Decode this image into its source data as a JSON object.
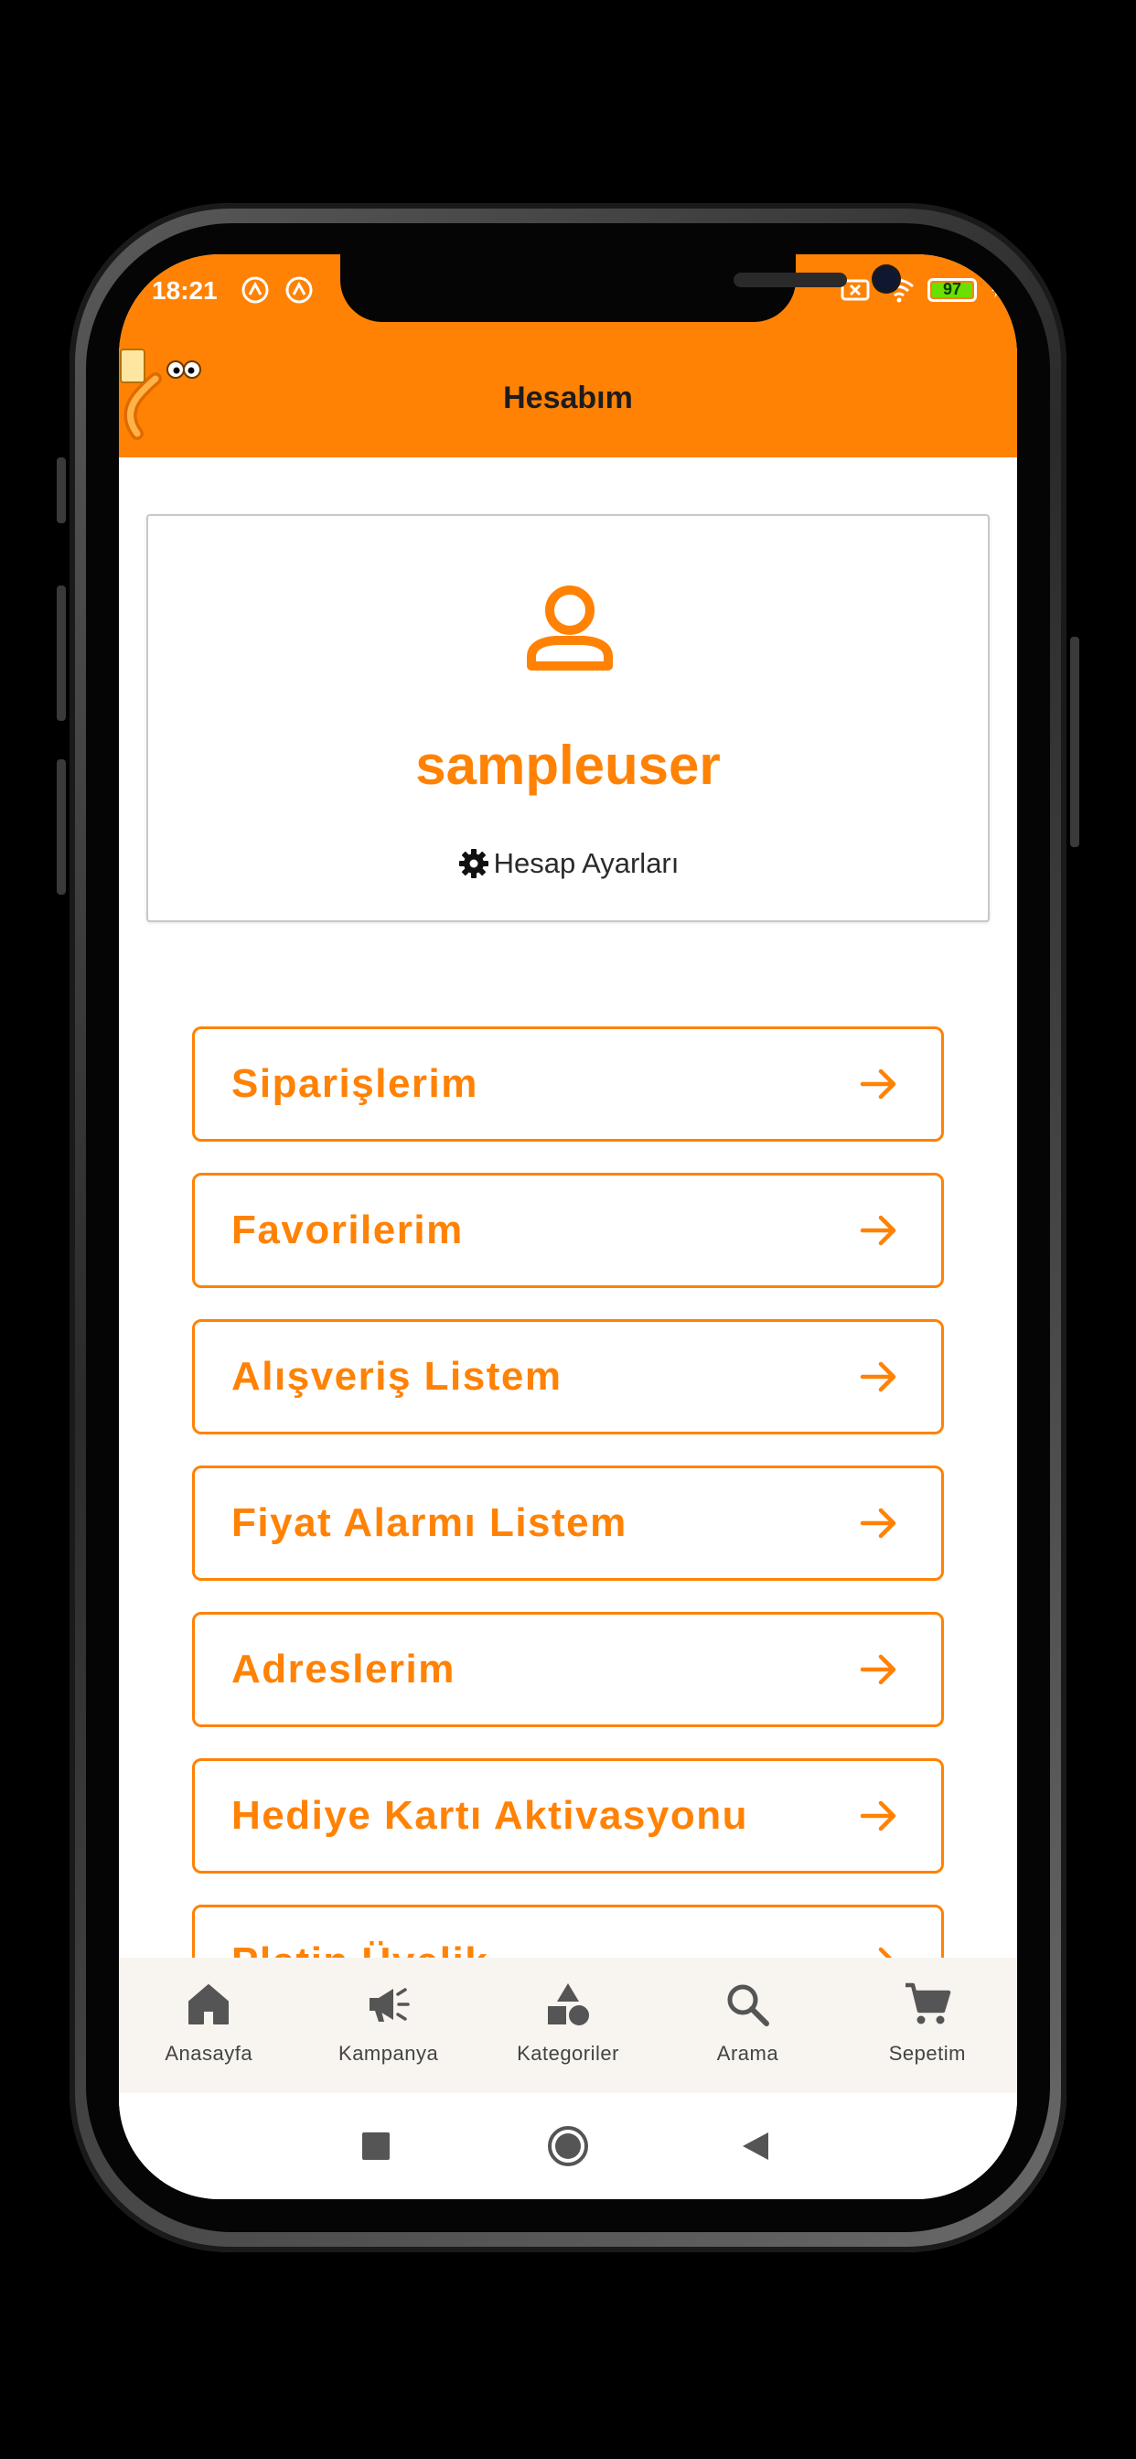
{
  "status_bar": {
    "time": "18:21",
    "battery": "97"
  },
  "header": {
    "title": "Hesabım",
    "bg_color": "#ff8205"
  },
  "profile": {
    "username": "sampleuser",
    "settings_label": "Hesap Ayarları"
  },
  "menu": [
    {
      "label": "Siparişlerim"
    },
    {
      "label": "Favorilerim"
    },
    {
      "label": "Alışveriş Listem"
    },
    {
      "label": "Fiyat Alarmı Listem"
    },
    {
      "label": "Adreslerim"
    },
    {
      "label": "Hediye Kartı Aktivasyonu"
    },
    {
      "label": "Platin Üyelik"
    }
  ],
  "bottom_nav": [
    {
      "label": "Anasayfa",
      "icon": "home-icon"
    },
    {
      "label": "Kampanya",
      "icon": "megaphone-icon"
    },
    {
      "label": "Kategoriler",
      "icon": "categories-icon"
    },
    {
      "label": "Arama",
      "icon": "search-icon"
    },
    {
      "label": "Sepetim",
      "icon": "cart-icon"
    }
  ],
  "colors": {
    "accent": "#ff8205",
    "nav_bg": "#f8f4f0"
  }
}
